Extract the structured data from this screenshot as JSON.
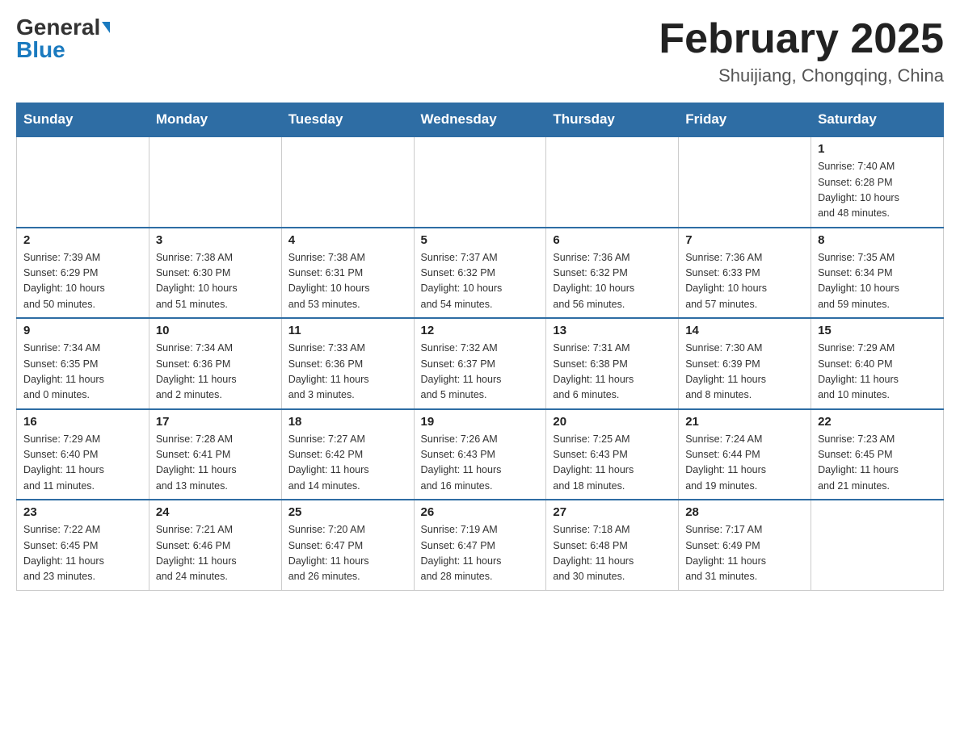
{
  "header": {
    "logo_general": "General",
    "logo_blue": "Blue",
    "month_title": "February 2025",
    "location": "Shuijiang, Chongqing, China"
  },
  "days_of_week": [
    "Sunday",
    "Monday",
    "Tuesday",
    "Wednesday",
    "Thursday",
    "Friday",
    "Saturday"
  ],
  "weeks": [
    {
      "days": [
        {
          "number": "",
          "info": ""
        },
        {
          "number": "",
          "info": ""
        },
        {
          "number": "",
          "info": ""
        },
        {
          "number": "",
          "info": ""
        },
        {
          "number": "",
          "info": ""
        },
        {
          "number": "",
          "info": ""
        },
        {
          "number": "1",
          "info": "Sunrise: 7:40 AM\nSunset: 6:28 PM\nDaylight: 10 hours\nand 48 minutes."
        }
      ]
    },
    {
      "days": [
        {
          "number": "2",
          "info": "Sunrise: 7:39 AM\nSunset: 6:29 PM\nDaylight: 10 hours\nand 50 minutes."
        },
        {
          "number": "3",
          "info": "Sunrise: 7:38 AM\nSunset: 6:30 PM\nDaylight: 10 hours\nand 51 minutes."
        },
        {
          "number": "4",
          "info": "Sunrise: 7:38 AM\nSunset: 6:31 PM\nDaylight: 10 hours\nand 53 minutes."
        },
        {
          "number": "5",
          "info": "Sunrise: 7:37 AM\nSunset: 6:32 PM\nDaylight: 10 hours\nand 54 minutes."
        },
        {
          "number": "6",
          "info": "Sunrise: 7:36 AM\nSunset: 6:32 PM\nDaylight: 10 hours\nand 56 minutes."
        },
        {
          "number": "7",
          "info": "Sunrise: 7:36 AM\nSunset: 6:33 PM\nDaylight: 10 hours\nand 57 minutes."
        },
        {
          "number": "8",
          "info": "Sunrise: 7:35 AM\nSunset: 6:34 PM\nDaylight: 10 hours\nand 59 minutes."
        }
      ]
    },
    {
      "days": [
        {
          "number": "9",
          "info": "Sunrise: 7:34 AM\nSunset: 6:35 PM\nDaylight: 11 hours\nand 0 minutes."
        },
        {
          "number": "10",
          "info": "Sunrise: 7:34 AM\nSunset: 6:36 PM\nDaylight: 11 hours\nand 2 minutes."
        },
        {
          "number": "11",
          "info": "Sunrise: 7:33 AM\nSunset: 6:36 PM\nDaylight: 11 hours\nand 3 minutes."
        },
        {
          "number": "12",
          "info": "Sunrise: 7:32 AM\nSunset: 6:37 PM\nDaylight: 11 hours\nand 5 minutes."
        },
        {
          "number": "13",
          "info": "Sunrise: 7:31 AM\nSunset: 6:38 PM\nDaylight: 11 hours\nand 6 minutes."
        },
        {
          "number": "14",
          "info": "Sunrise: 7:30 AM\nSunset: 6:39 PM\nDaylight: 11 hours\nand 8 minutes."
        },
        {
          "number": "15",
          "info": "Sunrise: 7:29 AM\nSunset: 6:40 PM\nDaylight: 11 hours\nand 10 minutes."
        }
      ]
    },
    {
      "days": [
        {
          "number": "16",
          "info": "Sunrise: 7:29 AM\nSunset: 6:40 PM\nDaylight: 11 hours\nand 11 minutes."
        },
        {
          "number": "17",
          "info": "Sunrise: 7:28 AM\nSunset: 6:41 PM\nDaylight: 11 hours\nand 13 minutes."
        },
        {
          "number": "18",
          "info": "Sunrise: 7:27 AM\nSunset: 6:42 PM\nDaylight: 11 hours\nand 14 minutes."
        },
        {
          "number": "19",
          "info": "Sunrise: 7:26 AM\nSunset: 6:43 PM\nDaylight: 11 hours\nand 16 minutes."
        },
        {
          "number": "20",
          "info": "Sunrise: 7:25 AM\nSunset: 6:43 PM\nDaylight: 11 hours\nand 18 minutes."
        },
        {
          "number": "21",
          "info": "Sunrise: 7:24 AM\nSunset: 6:44 PM\nDaylight: 11 hours\nand 19 minutes."
        },
        {
          "number": "22",
          "info": "Sunrise: 7:23 AM\nSunset: 6:45 PM\nDaylight: 11 hours\nand 21 minutes."
        }
      ]
    },
    {
      "days": [
        {
          "number": "23",
          "info": "Sunrise: 7:22 AM\nSunset: 6:45 PM\nDaylight: 11 hours\nand 23 minutes."
        },
        {
          "number": "24",
          "info": "Sunrise: 7:21 AM\nSunset: 6:46 PM\nDaylight: 11 hours\nand 24 minutes."
        },
        {
          "number": "25",
          "info": "Sunrise: 7:20 AM\nSunset: 6:47 PM\nDaylight: 11 hours\nand 26 minutes."
        },
        {
          "number": "26",
          "info": "Sunrise: 7:19 AM\nSunset: 6:47 PM\nDaylight: 11 hours\nand 28 minutes."
        },
        {
          "number": "27",
          "info": "Sunrise: 7:18 AM\nSunset: 6:48 PM\nDaylight: 11 hours\nand 30 minutes."
        },
        {
          "number": "28",
          "info": "Sunrise: 7:17 AM\nSunset: 6:49 PM\nDaylight: 11 hours\nand 31 minutes."
        },
        {
          "number": "",
          "info": ""
        }
      ]
    }
  ]
}
